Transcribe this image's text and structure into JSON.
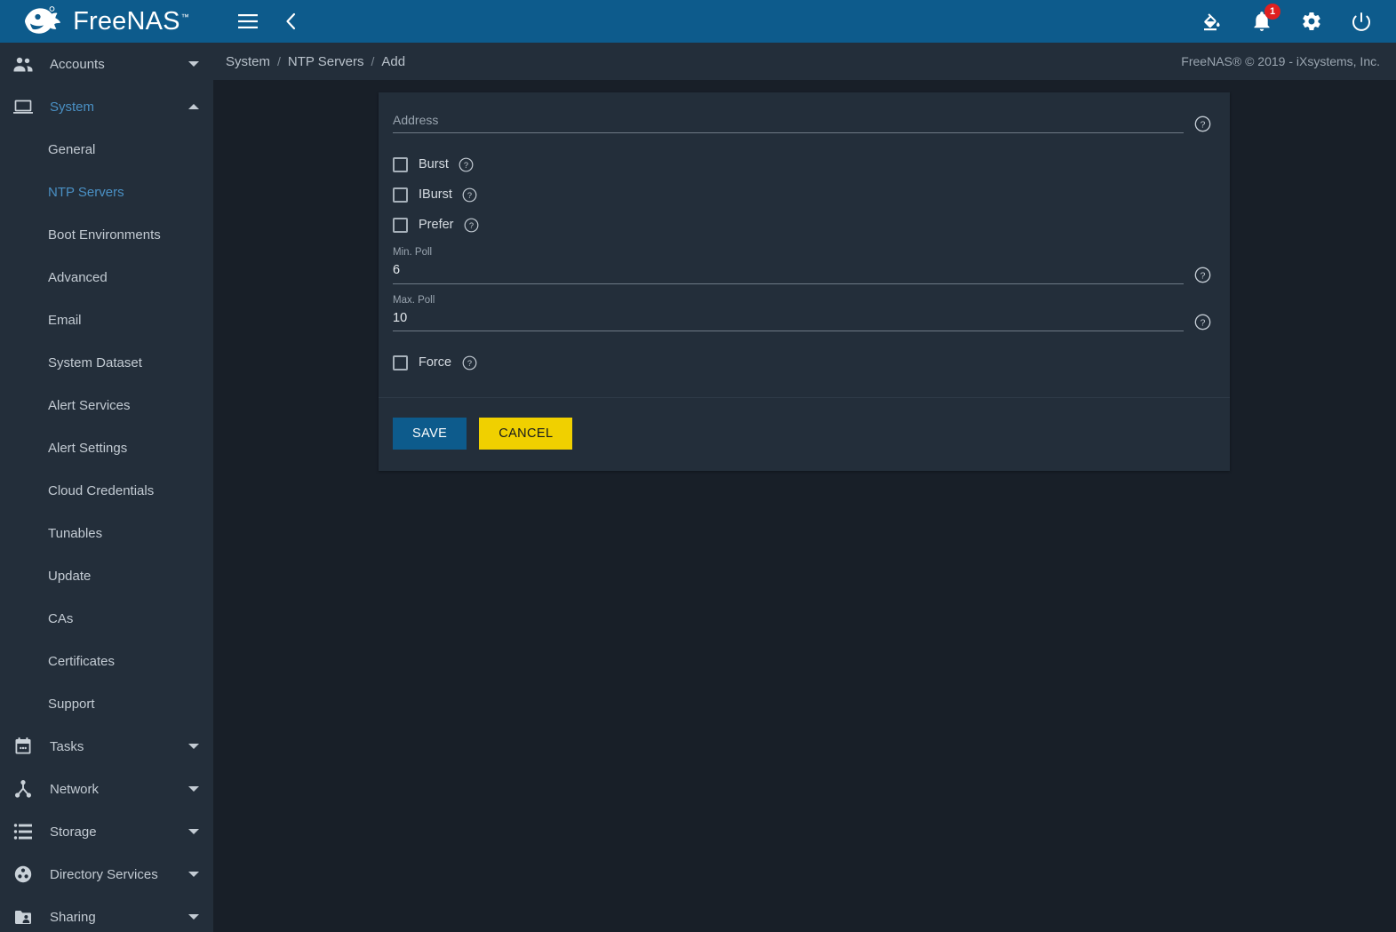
{
  "app": {
    "brand_name": "FreeNAS",
    "brand_tm": "™",
    "accent_blue": "#0d5b8c",
    "sidebar_bg": "#232e3a",
    "content_bg": "#181f28",
    "active_link": "#4a90c4",
    "cancel_yellow": "#f0d000",
    "badge_red": "#e02020"
  },
  "topbar": {
    "menu_icon": "hamburger-icon",
    "back_icon": "chevron-left-icon",
    "theme_icon": "paint-bucket-icon",
    "notifications_icon": "bell-icon",
    "notifications_count": "1",
    "settings_icon": "gear-icon",
    "power_icon": "power-icon"
  },
  "breadcrumb": {
    "items": [
      "System",
      "NTP Servers",
      "Add"
    ],
    "separator": "/",
    "copyright": "FreeNAS® © 2019 - iXsystems, Inc."
  },
  "sidebar": {
    "groups": [
      {
        "label": "Accounts",
        "icon": "people-icon",
        "expanded": false,
        "active": false,
        "children": []
      },
      {
        "label": "System",
        "icon": "laptop-icon",
        "expanded": true,
        "active": true,
        "children": [
          {
            "label": "General",
            "active": false
          },
          {
            "label": "NTP Servers",
            "active": true
          },
          {
            "label": "Boot Environments",
            "active": false
          },
          {
            "label": "Advanced",
            "active": false
          },
          {
            "label": "Email",
            "active": false
          },
          {
            "label": "System Dataset",
            "active": false
          },
          {
            "label": "Alert Services",
            "active": false
          },
          {
            "label": "Alert Settings",
            "active": false
          },
          {
            "label": "Cloud Credentials",
            "active": false
          },
          {
            "label": "Tunables",
            "active": false
          },
          {
            "label": "Update",
            "active": false
          },
          {
            "label": "CAs",
            "active": false
          },
          {
            "label": "Certificates",
            "active": false
          },
          {
            "label": "Support",
            "active": false
          }
        ]
      },
      {
        "label": "Tasks",
        "icon": "calendar-icon",
        "expanded": false,
        "active": false,
        "children": []
      },
      {
        "label": "Network",
        "icon": "network-icon",
        "expanded": false,
        "active": false,
        "children": []
      },
      {
        "label": "Storage",
        "icon": "storage-icon",
        "expanded": false,
        "active": false,
        "children": []
      },
      {
        "label": "Directory Services",
        "icon": "directory-icon",
        "expanded": false,
        "active": false,
        "children": []
      },
      {
        "label": "Sharing",
        "icon": "sharing-icon",
        "expanded": false,
        "active": false,
        "children": []
      }
    ]
  },
  "form": {
    "address": {
      "label": "Address",
      "placeholder": "Address",
      "value": "",
      "help_icon": "help-circle-icon"
    },
    "burst": {
      "label": "Burst",
      "checked": false,
      "help_icon": "help-circle-icon"
    },
    "iburst": {
      "label": "IBurst",
      "checked": false,
      "help_icon": "help-circle-icon"
    },
    "prefer": {
      "label": "Prefer",
      "checked": false,
      "help_icon": "help-circle-icon"
    },
    "min_poll": {
      "label": "Min. Poll",
      "value": "6",
      "help_icon": "help-circle-icon"
    },
    "max_poll": {
      "label": "Max. Poll",
      "value": "10",
      "help_icon": "help-circle-icon"
    },
    "force": {
      "label": "Force",
      "checked": false,
      "help_icon": "help-circle-icon"
    },
    "save_label": "SAVE",
    "cancel_label": "CANCEL"
  }
}
